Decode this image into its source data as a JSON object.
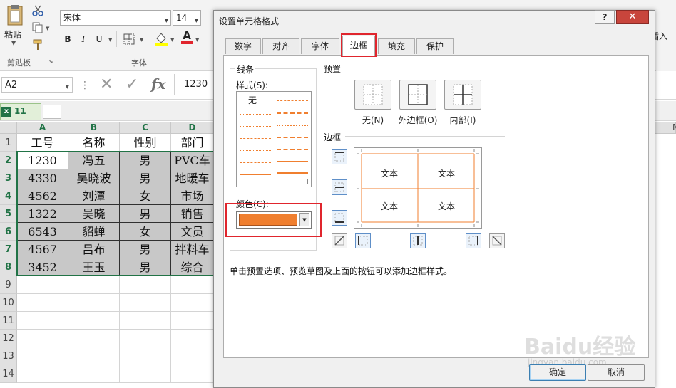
{
  "ribbon": {
    "clipboard": {
      "paste_label": "粘贴",
      "group_label": "剪贴板"
    },
    "font": {
      "font_name": "宋体",
      "font_size": "14",
      "bold": "B",
      "italic": "I",
      "underline": "U",
      "font_color_glyph": "A",
      "group_label": "字体"
    },
    "right_fragment_label": "插入"
  },
  "formula_bar": {
    "name_box": "A2",
    "fx": "fx",
    "value": "1230"
  },
  "workbook_tab": {
    "label": "11"
  },
  "sheet": {
    "columns": [
      "A",
      "B",
      "C",
      "D"
    ],
    "right_col_fragment": "N",
    "rows": [
      "1",
      "2",
      "3",
      "4",
      "5",
      "6",
      "7",
      "8",
      "9",
      "10",
      "11",
      "12",
      "13",
      "14"
    ],
    "header": [
      "工号",
      "名称",
      "性别",
      "部门"
    ],
    "data": [
      [
        "1230",
        "冯五",
        "男",
        "PVC车"
      ],
      [
        "4330",
        "吴晓波",
        "男",
        "地暖车"
      ],
      [
        "4562",
        "刘潭",
        "女",
        "市场"
      ],
      [
        "1322",
        "吴晓",
        "男",
        "销售"
      ],
      [
        "6543",
        "貂蝉",
        "女",
        "文员"
      ],
      [
        "4567",
        "吕布",
        "男",
        "拌料车"
      ],
      [
        "3452",
        "王玉",
        "男",
        "综合"
      ]
    ]
  },
  "dialog": {
    "title": "设置单元格格式",
    "help": "?",
    "close": "✕",
    "tabs": [
      "数字",
      "对齐",
      "字体",
      "边框",
      "填充",
      "保护"
    ],
    "active_tab": "边框",
    "line_section": {
      "label": "线条",
      "style_label": "样式(S):",
      "none_label": "无",
      "color_label": "颜色(C):",
      "color_value": "#f07f2f"
    },
    "preset_section": {
      "label": "预置",
      "buttons": [
        {
          "label": "无(N)"
        },
        {
          "label": "外边框(O)"
        },
        {
          "label": "内部(I)"
        }
      ]
    },
    "border_section": {
      "label": "边框",
      "preview_text": [
        "文本",
        "文本",
        "文本",
        "文本"
      ]
    },
    "hint": "单击预置选项、预览草图及上面的按钮可以添加边框样式。",
    "ok": "确定",
    "cancel": "取消"
  },
  "watermark": {
    "text": "Baidu经验",
    "sub": "jingyan.baidu.com"
  },
  "colors": {
    "accent_green": "#217346",
    "highlight_red": "#e0252d",
    "orange_line": "#f07f2f"
  }
}
